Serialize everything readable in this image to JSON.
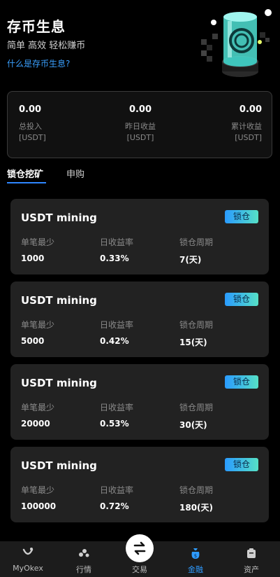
{
  "hero": {
    "title": "存币生息",
    "subtitle": "简单 高效 轻松赚币",
    "link": "什么是存币生息?"
  },
  "summary": {
    "stats": [
      {
        "value": "0.00",
        "label": "总投入",
        "unit": "[USDT]"
      },
      {
        "value": "0.00",
        "label": "昨日收益",
        "unit": "[USDT]"
      },
      {
        "value": "0.00",
        "label": "累计收益",
        "unit": "[USDT]"
      }
    ]
  },
  "tabs": [
    {
      "label": "锁仓挖矿",
      "active": true
    },
    {
      "label": "申购",
      "active": false
    }
  ],
  "cards": [
    {
      "title": "USDT mining",
      "badge": "锁仓",
      "min_label": "单笔最少",
      "min_value": "1000",
      "rate_label": "日收益率",
      "rate_value": "0.33%",
      "period_label": "锁仓周期",
      "period_value": "7(天)"
    },
    {
      "title": "USDT mining",
      "badge": "锁仓",
      "min_label": "单笔最少",
      "min_value": "5000",
      "rate_label": "日收益率",
      "rate_value": "0.42%",
      "period_label": "锁仓周期",
      "period_value": "15(天)"
    },
    {
      "title": "USDT mining",
      "badge": "锁仓",
      "min_label": "单笔最少",
      "min_value": "20000",
      "rate_label": "日收益率",
      "rate_value": "0.53%",
      "period_label": "锁仓周期",
      "period_value": "30(天)"
    },
    {
      "title": "USDT mining",
      "badge": "锁仓",
      "min_label": "单笔最少",
      "min_value": "100000",
      "rate_label": "日收益率",
      "rate_value": "0.72%",
      "period_label": "锁仓周期",
      "period_value": "180(天)"
    }
  ],
  "bottom_nav": [
    {
      "label": "MyOkex",
      "icon": "okex-logo-icon"
    },
    {
      "label": "行情",
      "icon": "market-icon"
    },
    {
      "label": "交易",
      "icon": "trade-swap-icon"
    },
    {
      "label": "金融",
      "icon": "finance-bag-icon",
      "active": true
    },
    {
      "label": "资产",
      "icon": "wallet-icon"
    }
  ],
  "colors": {
    "accent": "#2e9bff",
    "badge_gradient_start": "#2a9bff",
    "badge_gradient_end": "#56e0c6",
    "card_bg": "#222222"
  }
}
